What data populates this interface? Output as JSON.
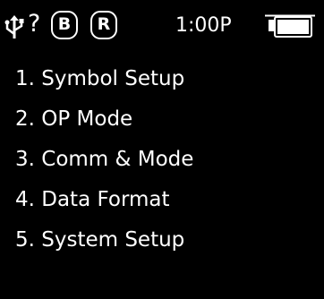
{
  "status_bar": {
    "connection_icon": "usb-icon",
    "help_glyph": "?",
    "badges": [
      "B",
      "R"
    ],
    "time": "1:00P",
    "battery_icon": "battery-icon",
    "battery_level": 1.0
  },
  "menu": {
    "items": [
      "1. Symbol Setup",
      "2. OP Mode",
      "3. Comm & Mode",
      "4. Data Format",
      "5. System Setup"
    ]
  },
  "colors": {
    "background": "#000000",
    "foreground": "#ffffff"
  }
}
